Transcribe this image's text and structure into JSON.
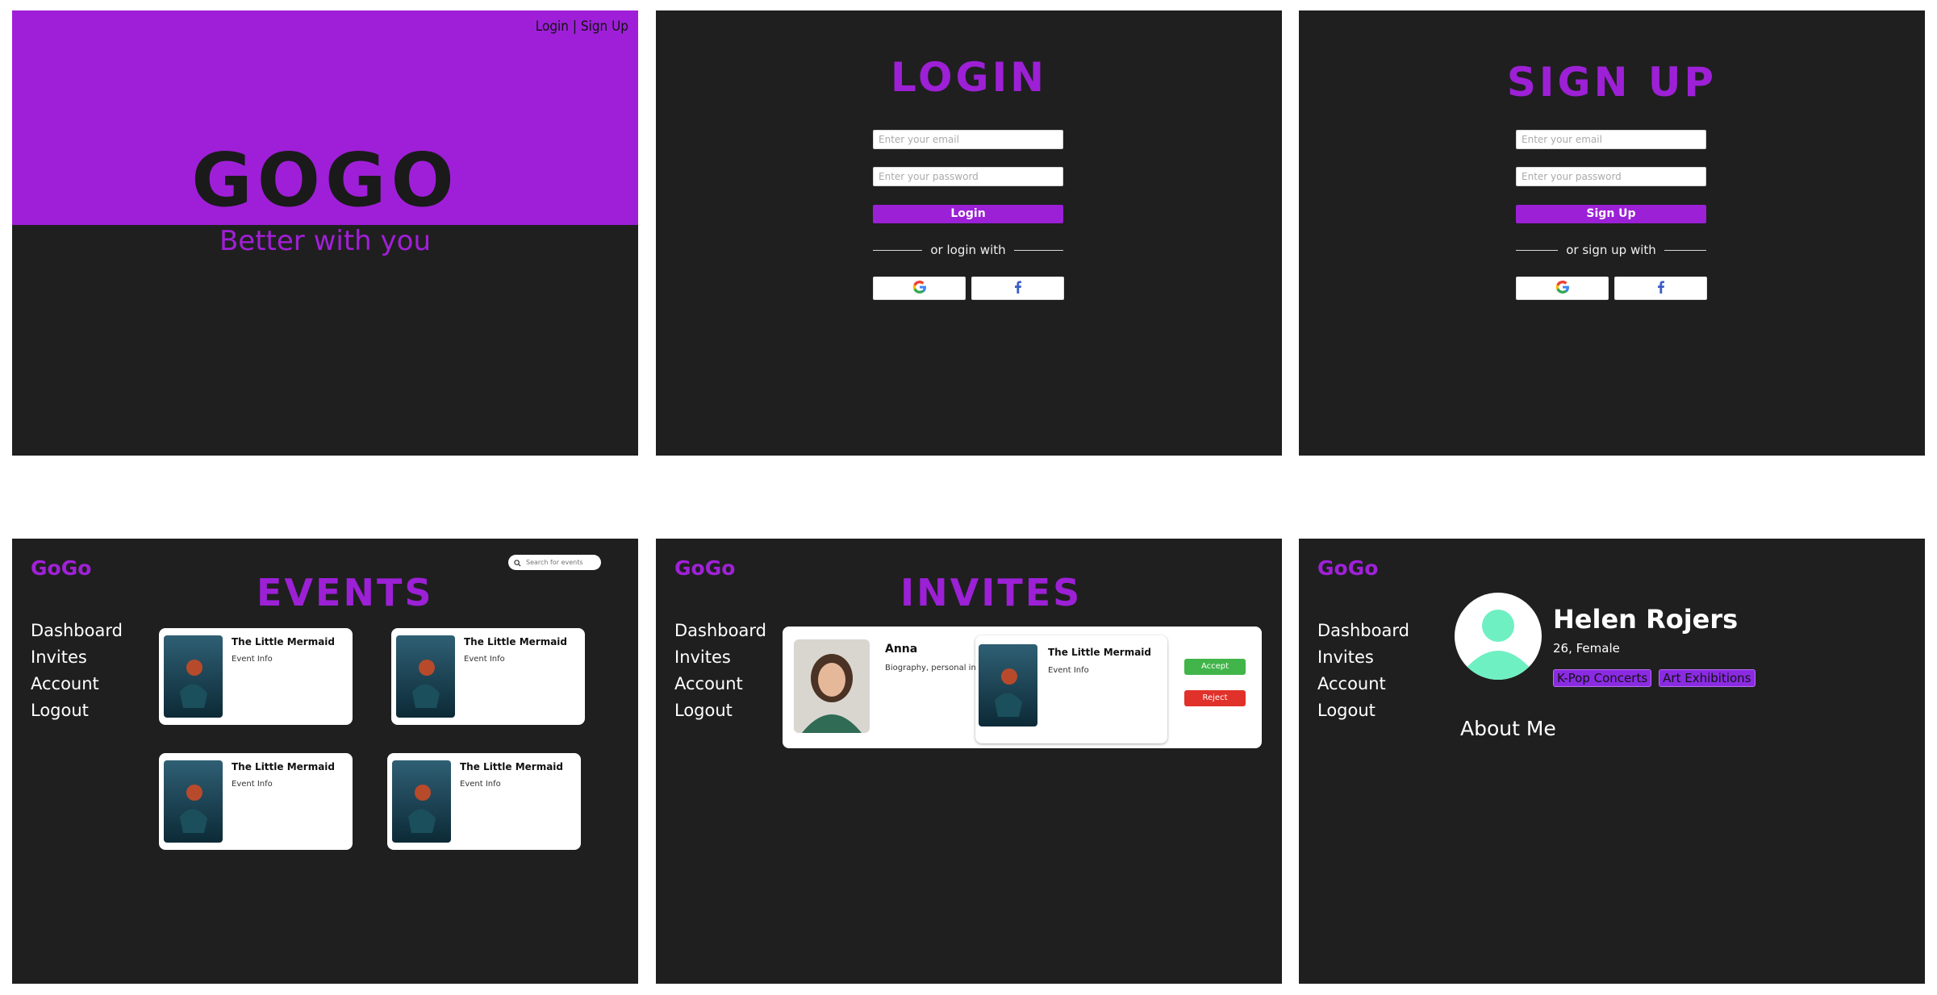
{
  "landing": {
    "top_links": "Login | Sign Up",
    "brand": "GOGO",
    "tagline": "Better with you"
  },
  "login": {
    "title": "LOGIN",
    "email_placeholder": "Enter your email",
    "password_placeholder": "Enter your password",
    "button": "Login",
    "divider": "or login with",
    "social": [
      "google-icon",
      "facebook-icon"
    ]
  },
  "signup": {
    "title": "SIGN UP",
    "email_placeholder": "Enter your email",
    "password_placeholder": "Enter your password",
    "button": "Sign Up",
    "divider": "or sign up with"
  },
  "app": {
    "logo": "GoGo",
    "nav": [
      "Dashboard",
      "Invites",
      "Account",
      "Logout"
    ]
  },
  "events": {
    "title": "EVENTS",
    "search_placeholder": "Search for events",
    "cards": [
      {
        "title": "The Little Mermaid",
        "info": "Event Info"
      },
      {
        "title": "The Little Mermaid",
        "info": "Event Info"
      },
      {
        "title": "The Little Mermaid",
        "info": "Event Info"
      },
      {
        "title": "The Little Mermaid",
        "info": "Event Info"
      }
    ]
  },
  "invites": {
    "title": "INVITES",
    "person_name": "Anna",
    "person_bio": "Biography, personal info",
    "event_title": "The Little Mermaid",
    "event_info": "Event Info",
    "accept": "Accept",
    "reject": "Reject"
  },
  "profile": {
    "name": "Helen Rojers",
    "meta": "26, Female",
    "tags": [
      "K-Pop Concerts",
      "Art Exhibitions"
    ],
    "about": "About Me"
  },
  "colors": {
    "purple": "#9f1fd8",
    "dark": "#1f1f1f",
    "accept": "#41b549",
    "reject": "#e0312a",
    "avatar": "#6ff0c3"
  }
}
